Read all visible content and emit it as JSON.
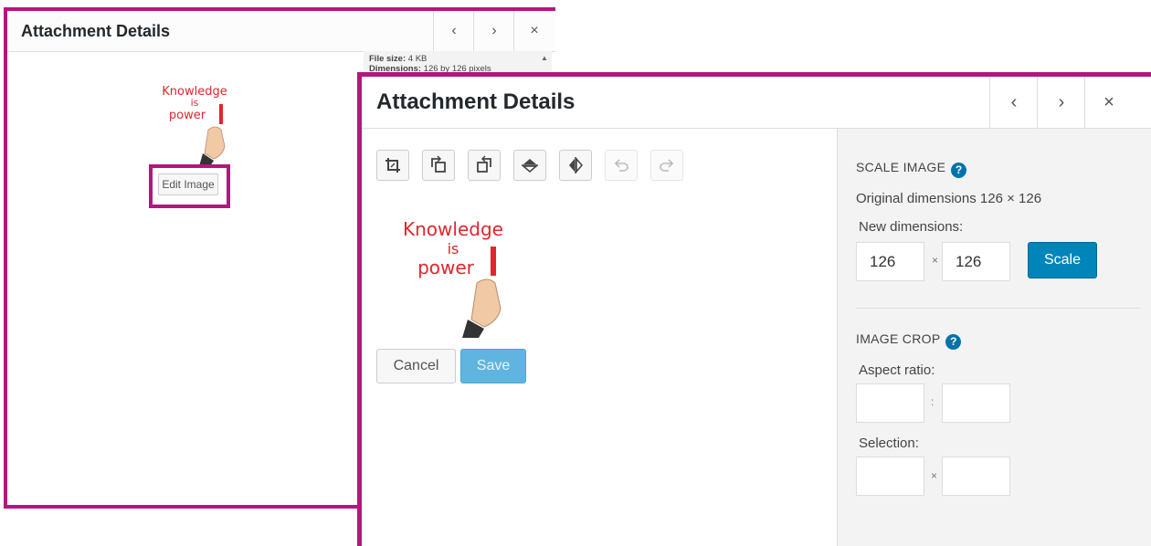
{
  "back_panel": {
    "title": "Attachment Details",
    "file_size_label": "File size:",
    "file_size_value": "4 KB",
    "dimensions_label": "Dimensions:",
    "dimensions_value": "126 by 126 pixels",
    "edit_image_label": "Edit Image",
    "image_text": [
      "Knowledge",
      "is",
      "power"
    ]
  },
  "front_panel": {
    "title": "Attachment Details",
    "cancel_label": "Cancel",
    "save_label": "Save",
    "image_text": [
      "Knowledge",
      "is",
      "power"
    ],
    "tools": [
      {
        "name": "crop",
        "icon": "crop-icon",
        "enabled": true
      },
      {
        "name": "rotate-left",
        "icon": "rotate-left-icon",
        "enabled": true
      },
      {
        "name": "rotate-right",
        "icon": "rotate-right-icon",
        "enabled": true
      },
      {
        "name": "flip-vertical",
        "icon": "flip-vertical-icon",
        "enabled": true
      },
      {
        "name": "flip-horizontal",
        "icon": "flip-horizontal-icon",
        "enabled": true
      },
      {
        "name": "undo",
        "icon": "undo-icon",
        "enabled": false
      },
      {
        "name": "redo",
        "icon": "redo-icon",
        "enabled": false
      }
    ],
    "sidebar": {
      "scale_title": "SCALE IMAGE",
      "original_dimensions": "Original dimensions 126 × 126",
      "new_dimensions_label": "New dimensions:",
      "new_width": "126",
      "new_height": "126",
      "times_sep": "×",
      "scale_button": "Scale",
      "crop_title": "IMAGE CROP",
      "aspect_ratio_label": "Aspect ratio:",
      "ratio_sep": ":",
      "selection_label": "Selection:"
    }
  },
  "nav": {
    "prev": "‹",
    "next": "›",
    "close": "×"
  },
  "colors": {
    "highlight": "#b5167e",
    "primary": "#0085ba",
    "save_disabled": "#5fb5e0",
    "handwriting": "#e0262d"
  }
}
